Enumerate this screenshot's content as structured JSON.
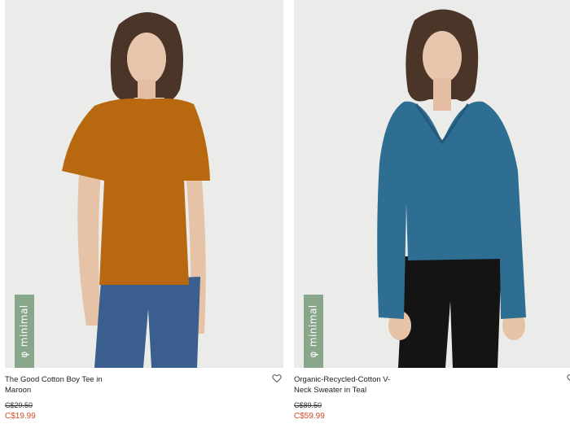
{
  "products": [
    {
      "name": "The Good Cotton Boy Tee in Maroon",
      "badge": "minimal",
      "badge_icon": "phi-icon",
      "old_price": "C$29.50",
      "new_price": "C$19.99",
      "garment_color": "#b8680f"
    },
    {
      "name": "Organic-Recycled-Cotton V-Neck Sweater in Teal",
      "badge": "minimal",
      "badge_icon": "phi-icon",
      "old_price": "C$89.50",
      "new_price": "C$59.99",
      "garment_color": "#2e6e93"
    }
  ],
  "colors": {
    "badge_bg": "#88a68a",
    "sale_price": "#d14a2a",
    "photo_bg": "#ebebe9"
  }
}
